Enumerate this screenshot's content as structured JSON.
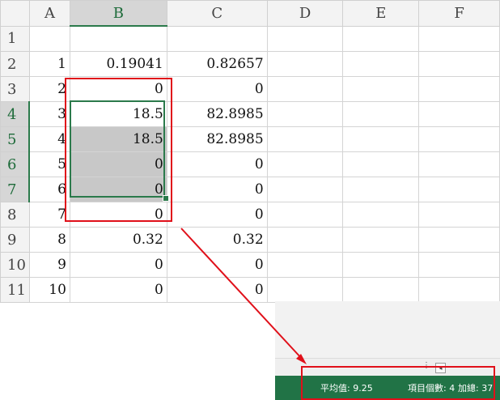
{
  "columns": [
    "A",
    "B",
    "C",
    "D",
    "E",
    "F"
  ],
  "rows": [
    {
      "num": "1",
      "a": "",
      "b": "",
      "c": ""
    },
    {
      "num": "2",
      "a": "1",
      "b": "0.19041",
      "c": "0.82657"
    },
    {
      "num": "3",
      "a": "2",
      "b": "0",
      "c": "0"
    },
    {
      "num": "4",
      "a": "3",
      "b": "18.5",
      "c": "82.8985"
    },
    {
      "num": "5",
      "a": "4",
      "b": "18.5",
      "c": "82.8985"
    },
    {
      "num": "6",
      "a": "5",
      "b": "0",
      "c": "0"
    },
    {
      "num": "7",
      "a": "6",
      "b": "0",
      "c": "0"
    },
    {
      "num": "8",
      "a": "7",
      "b": "0",
      "c": "0"
    },
    {
      "num": "9",
      "a": "8",
      "b": "0.32",
      "c": "0.32"
    },
    {
      "num": "10",
      "a": "9",
      "b": "0",
      "c": "0"
    },
    {
      "num": "11",
      "a": "10",
      "b": "0",
      "c": "0"
    }
  ],
  "statusbar": {
    "average": "平均值: 9.25",
    "count": "項目個數: 4",
    "sum": "加總: 37",
    "scroll_dots": "⋮",
    "scroll_left": "◂"
  },
  "colors": {
    "excel_green": "#217346",
    "annotation_red": "#e0101a",
    "selection_green": "#2b7a4b"
  }
}
